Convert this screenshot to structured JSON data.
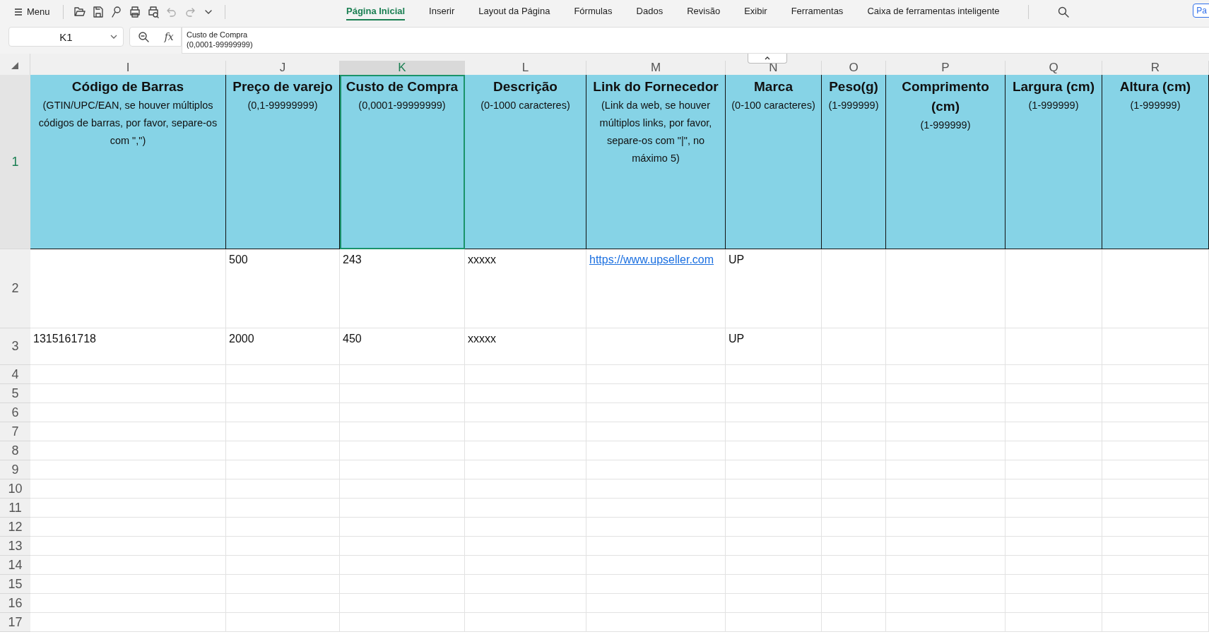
{
  "toolbar": {
    "menu_label": "Menu",
    "tabs": [
      {
        "label": "Página Inicial",
        "selected": true
      },
      {
        "label": "Inserir",
        "selected": false
      },
      {
        "label": "Layout da Página",
        "selected": false
      },
      {
        "label": "Fórmulas",
        "selected": false
      },
      {
        "label": "Dados",
        "selected": false
      },
      {
        "label": "Revisão",
        "selected": false
      },
      {
        "label": "Exibir",
        "selected": false
      },
      {
        "label": "Ferramentas",
        "selected": false
      },
      {
        "label": "Caixa de ferramentas inteligente",
        "selected": false
      }
    ],
    "corner_button": "Pa"
  },
  "formula_bar": {
    "name_box": "K1",
    "fx_label": "fx",
    "content": "Custo de Compra\n(0,0001-99999999)"
  },
  "sheet": {
    "columns": [
      {
        "label": "I",
        "selected": false
      },
      {
        "label": "J",
        "selected": false
      },
      {
        "label": "K",
        "selected": true
      },
      {
        "label": "L",
        "selected": false
      },
      {
        "label": "M",
        "selected": false
      },
      {
        "label": "N",
        "selected": false
      },
      {
        "label": "O",
        "selected": false
      },
      {
        "label": "P",
        "selected": false
      },
      {
        "label": "Q",
        "selected": false
      },
      {
        "label": "R",
        "selected": false
      }
    ],
    "header_row": {
      "label": "1",
      "selected": true,
      "cells": [
        {
          "title": "Código de Barras",
          "subtitle": "(GTIN/UPC/EAN, se houver múltiplos códigos de barras, por favor, separe-os com \",\")",
          "selected": false
        },
        {
          "title": "Preço de varejo",
          "subtitle": "(0,1-99999999)",
          "selected": false
        },
        {
          "title": "Custo de Compra",
          "subtitle": "(0,0001-99999999)",
          "selected": true
        },
        {
          "title": "Descrição",
          "subtitle": "(0-1000 caracteres)",
          "selected": false
        },
        {
          "title": "Link do Fornecedor",
          "subtitle": "(Link da web, se houver múltiplos links, por favor, separe-os com \"|\", no máximo 5)",
          "selected": false
        },
        {
          "title": "Marca",
          "subtitle": "(0-100 caracteres)",
          "selected": false
        },
        {
          "title": "Peso(g)",
          "subtitle": "(1-999999)",
          "selected": false
        },
        {
          "title": "Comprimento (cm)",
          "subtitle": "(1-999999)",
          "selected": false
        },
        {
          "title": "Largura (cm)",
          "subtitle": "(1-999999)",
          "selected": false
        },
        {
          "title": "Altura (cm)",
          "subtitle": "(1-999999)",
          "selected": false
        }
      ]
    },
    "rows": [
      {
        "label": "2",
        "selected": false,
        "cells": [
          {
            "kind": "empty"
          },
          {
            "kind": "text",
            "text": "500"
          },
          {
            "kind": "text",
            "text": "243"
          },
          {
            "kind": "text",
            "text": "xxxxx"
          },
          {
            "kind": "link",
            "text": "https://www.upseller.com"
          },
          {
            "kind": "text",
            "text": "UP"
          }
        ]
      },
      {
        "label": "3",
        "selected": false,
        "cells": [
          {
            "kind": "text",
            "text": "1315161718"
          },
          {
            "kind": "text",
            "text": "2000"
          },
          {
            "kind": "text",
            "text": "450"
          },
          {
            "kind": "text",
            "text": "xxxxx"
          },
          {
            "kind": "empty"
          },
          {
            "kind": "text",
            "text": "UP"
          }
        ]
      },
      {
        "label": "4",
        "selected": false,
        "cells": []
      },
      {
        "label": "5",
        "selected": false,
        "cells": []
      },
      {
        "label": "6",
        "selected": false,
        "cells": []
      },
      {
        "label": "7",
        "selected": false,
        "cells": []
      },
      {
        "label": "8",
        "selected": false,
        "cells": []
      },
      {
        "label": "9",
        "selected": false,
        "cells": []
      },
      {
        "label": "10",
        "selected": false,
        "cells": []
      },
      {
        "label": "11",
        "selected": false,
        "cells": []
      },
      {
        "label": "12",
        "selected": false,
        "cells": []
      },
      {
        "label": "13",
        "selected": false,
        "cells": []
      },
      {
        "label": "14",
        "selected": false,
        "cells": []
      },
      {
        "label": "15",
        "selected": false,
        "cells": []
      },
      {
        "label": "16",
        "selected": false,
        "cells": []
      },
      {
        "label": "17",
        "selected": false,
        "cells": []
      }
    ]
  }
}
